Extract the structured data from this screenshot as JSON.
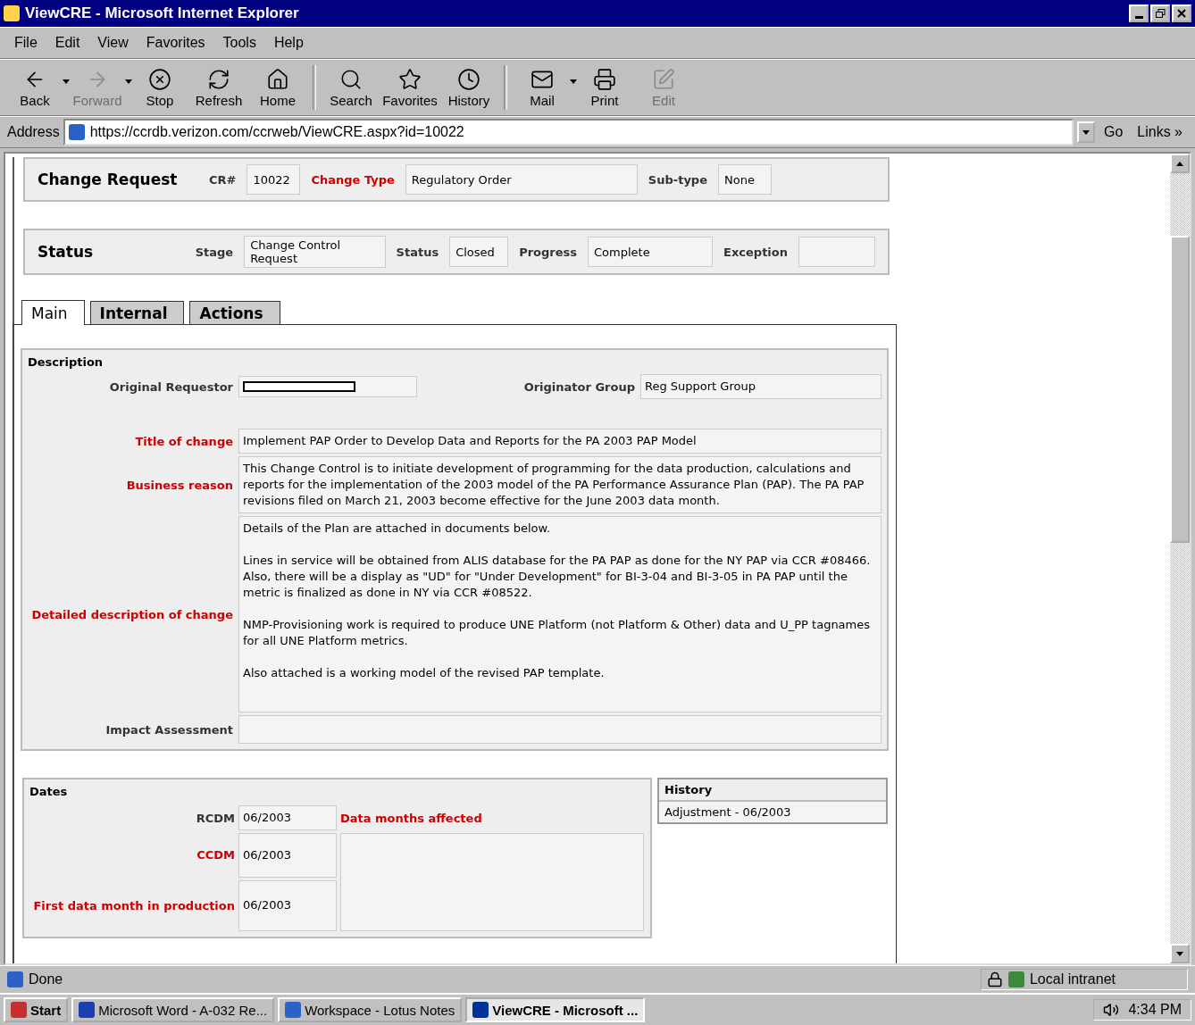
{
  "window": {
    "title": "ViewCRE - Microsoft Internet Explorer"
  },
  "menu": [
    "File",
    "Edit",
    "View",
    "Favorites",
    "Tools",
    "Help"
  ],
  "toolbar": [
    {
      "label": "Back",
      "disabled": false,
      "dropdown": true
    },
    {
      "label": "Forward",
      "disabled": true,
      "dropdown": true
    },
    {
      "label": "Stop",
      "disabled": false,
      "dropdown": false
    },
    {
      "label": "Refresh",
      "disabled": false,
      "dropdown": false
    },
    {
      "label": "Home",
      "disabled": false,
      "dropdown": false
    },
    {
      "label": "Search",
      "disabled": false,
      "dropdown": false
    },
    {
      "label": "Favorites",
      "disabled": false,
      "dropdown": false
    },
    {
      "label": "History",
      "disabled": false,
      "dropdown": false
    },
    {
      "label": "Mail",
      "disabled": false,
      "dropdown": true
    },
    {
      "label": "Print",
      "disabled": false,
      "dropdown": false
    },
    {
      "label": "Edit",
      "disabled": true,
      "dropdown": false
    }
  ],
  "address": {
    "label": "Address",
    "value": "https://ccrdb.verizon.com/ccrweb/ViewCRE.aspx?id=10022",
    "go": "Go",
    "links": "Links »"
  },
  "change_request": {
    "title": "Change Request",
    "fields": [
      {
        "label": "CR#",
        "value": "10022",
        "required": false
      },
      {
        "label": "Change Type",
        "value": "Regulatory Order",
        "required": true
      },
      {
        "label": "Sub-type",
        "value": "None",
        "required": false
      }
    ]
  },
  "status_panel": {
    "title": "Status",
    "fields": [
      {
        "label": "Stage",
        "value": "Change Control Request",
        "required": false
      },
      {
        "label": "Status",
        "value": "Closed",
        "required": false
      },
      {
        "label": "Progress",
        "value": "Complete",
        "required": false
      },
      {
        "label": "Exception",
        "required": false
      }
    ]
  },
  "tabs": [
    {
      "label": "Main",
      "selected": true
    },
    {
      "label": "Internal",
      "selected": false
    },
    {
      "label": "Actions",
      "selected": false
    }
  ],
  "description": {
    "heading": "Description",
    "requestor": {
      "label": "Original Requestor",
      "required": false
    },
    "originator": {
      "label": "Originator Group",
      "value": "Reg Support Group",
      "required": false
    },
    "rows": [
      {
        "label": "Title of change",
        "required": true,
        "value": "Implement PAP Order to Develop Data and Reports for the PA 2003 PAP Model"
      },
      {
        "label": "Business reason",
        "required": true,
        "value": "This Change Control is to initiate development of programming for the data production, calculations and reports for the implementation of the 2003 model of the PA Performance Assurance Plan (PAP). The PA PAP revisions filed on March 21, 2003 become effective for the June 2003 data month."
      },
      {
        "label": "Detailed description of change",
        "required": true,
        "value": "Details of the Plan are attached in documents below.\n\nLines in service will be obtained from ALIS database for the PA PAP as done for the NY PAP via CCR #08466. Also, there will be a display as \"UD\" for \"Under Development\" for BI-3-04 and BI-3-05 in PA PAP until the metric is finalized as done in NY via CCR #08522.\n\nNMP-Provisioning work is required to produce UNE Platform (not Platform & Other) data and U_PP tagnames for all UNE Platform metrics.\n\nAlso attached is a working model of the revised PAP template."
      },
      {
        "label": "Impact Assessment",
        "required": false
      }
    ]
  },
  "dates": {
    "heading": "Dates",
    "fields": [
      {
        "label": "RCDM",
        "value": "06/2003",
        "required": false
      },
      {
        "label": "CCDM",
        "value": "06/2003",
        "required": true
      },
      {
        "label": "First data month in production",
        "value": "06/2003",
        "required": true
      }
    ],
    "affected": {
      "label": "Data months affected",
      "required": true
    }
  },
  "history": {
    "heading": "History",
    "items": [
      "Adjustment - 06/2003"
    ]
  },
  "status_bar": {
    "text": "Done",
    "zone": "Local intranet"
  },
  "taskbar": {
    "start": "Start",
    "tasks": [
      {
        "label": "Microsoft Word - A-032 Re...",
        "selected": false
      },
      {
        "label": "Workspace - Lotus Notes",
        "selected": false
      },
      {
        "label": "ViewCRE - Microsoft ...",
        "selected": true
      }
    ],
    "time": "4:34 PM"
  }
}
